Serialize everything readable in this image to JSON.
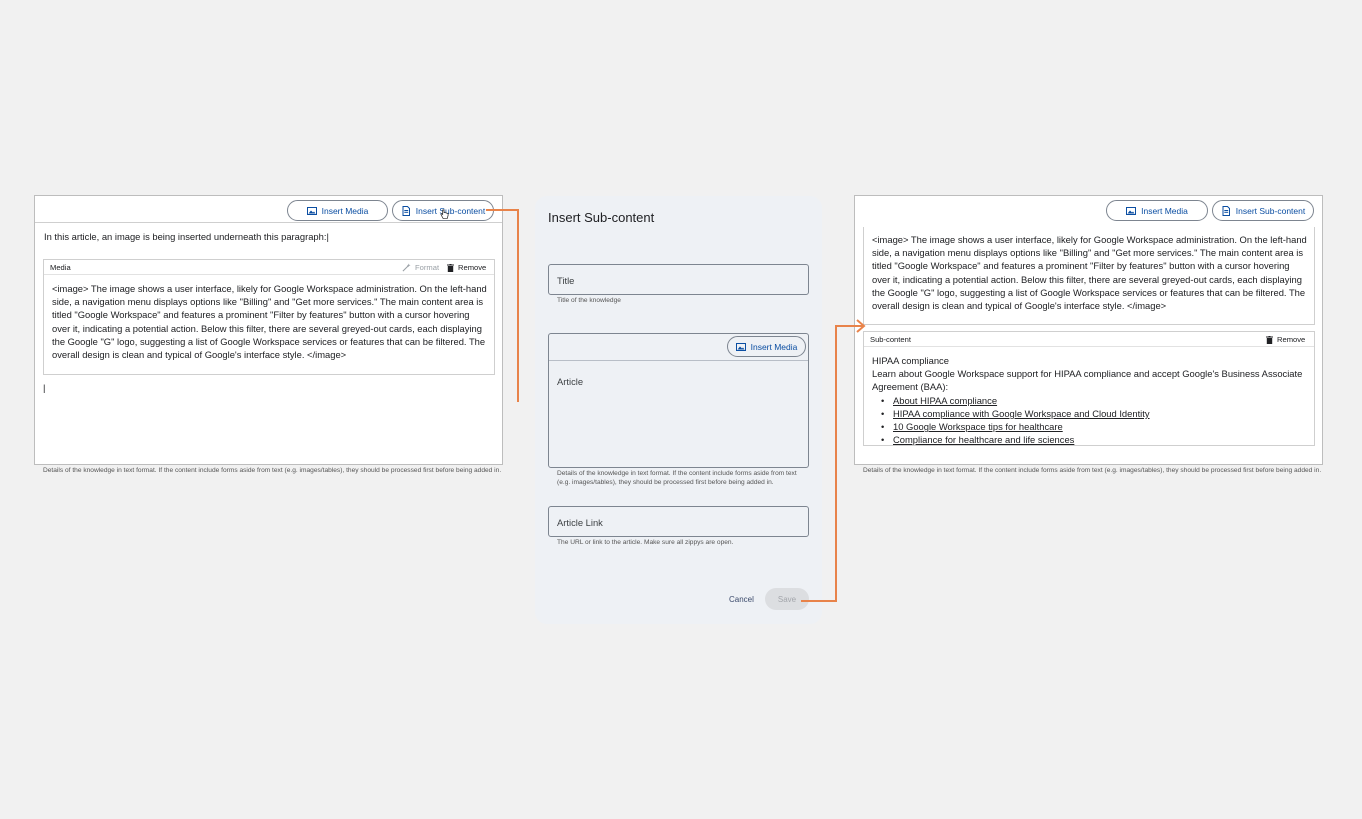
{
  "colors": {
    "accent": "#0b4ea2",
    "arrow": "#e8834a",
    "background": "#f1f1f1",
    "dialog": "#eef1f5"
  },
  "left_editor": {
    "insert_media_label": "Insert Media",
    "insert_subcontent_label": "Insert Sub-content",
    "paragraph": "In this article, an image is being inserted underneath this paragraph:|",
    "media_card": {
      "title": "Media",
      "format_label": "Format",
      "remove_label": "Remove",
      "body": "<image> The image shows a user interface, likely for Google Workspace administration. On the left-hand side, a navigation menu displays options like \"Billing\" and \"Get more services.\" The main content area is titled \"Google Workspace\" and features a prominent \"Filter by features\" button with a cursor hovering over it, indicating a potential action. Below this filter, there are several greyed-out cards, each displaying the Google \"G\" logo, suggesting a list of Google Workspace services or features that can be filtered. The overall design is clean and typical of Google's interface style. </image>"
    },
    "cursor": "|",
    "helper": "Details of the knowledge in text format. If the content include forms aside from text (e.g. images/tables), they should be processed first before being added in."
  },
  "dialog": {
    "title": "Insert Sub-content",
    "title_field_label": "Title",
    "title_helper": "Title of the knowledge",
    "insert_media_label": "Insert Media",
    "article_label": "Article",
    "article_helper": "Details of the knowledge in text format. If the content include forms aside from text (e.g. images/tables), they should be processed first before being added in.",
    "article_link_label": "Article Link",
    "article_link_helper": "The URL or link to the article. Make sure all zippys are open.",
    "cancel_label": "Cancel",
    "save_label": "Save"
  },
  "right_editor": {
    "insert_media_label": "Insert Media",
    "insert_subcontent_label": "Insert Sub-content",
    "media_text": "<image> The image shows a user interface, likely for Google Workspace administration. On the left-hand side, a navigation menu displays options like \"Billing\" and \"Get more services.\" The main content area is titled \"Google Workspace\" and features a prominent \"Filter by features\" button with a cursor hovering over it, indicating a potential action. Below this filter, there are several greyed-out cards, each displaying the Google \"G\" logo, suggesting a list of Google Workspace services or features that can be filtered. The overall design is clean and typical of Google's interface style. </image>",
    "subcontent_card": {
      "title": "Sub-content",
      "remove_label": "Remove",
      "heading": "HIPAA compliance",
      "intro": "Learn about Google Workspace support for HIPAA compliance and accept Google's Business Associate Agreement (BAA):",
      "links": [
        "About HIPAA compliance",
        "HIPAA compliance with Google Workspace and Cloud Identity",
        "10 Google Workspace tips for healthcare ",
        "Compliance for healthcare and life sciences"
      ]
    },
    "helper": "Details of the knowledge in text format. If the content include forms aside from text (e.g. images/tables), they should be processed first before being added in."
  },
  "icons": [
    "image-icon",
    "document-icon",
    "magic-wand-icon",
    "trash-icon",
    "hand-cursor-icon"
  ]
}
